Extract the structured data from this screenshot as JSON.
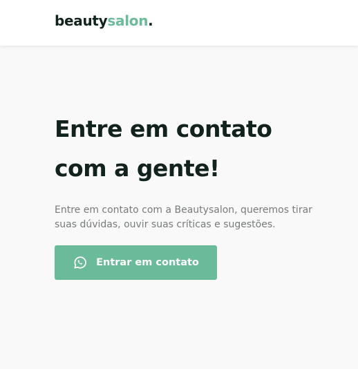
{
  "header": {
    "logo": {
      "part1": "beauty",
      "part2": "salon",
      "part3": "."
    }
  },
  "hero": {
    "title_line1": "Entre em contato",
    "title_line2": "com a gente!",
    "description": "Entre em contato com a Beautysalon, queremos tirar suas dúvidas, ouvir suas críticas e sugestões.",
    "cta_label": "Entrar em contato",
    "cta_icon": "whatsapp-icon"
  },
  "colors": {
    "accent": "#6bbb9a",
    "dark_text": "#12221c",
    "muted_text": "#777b79",
    "background": "#f9f9f9"
  }
}
